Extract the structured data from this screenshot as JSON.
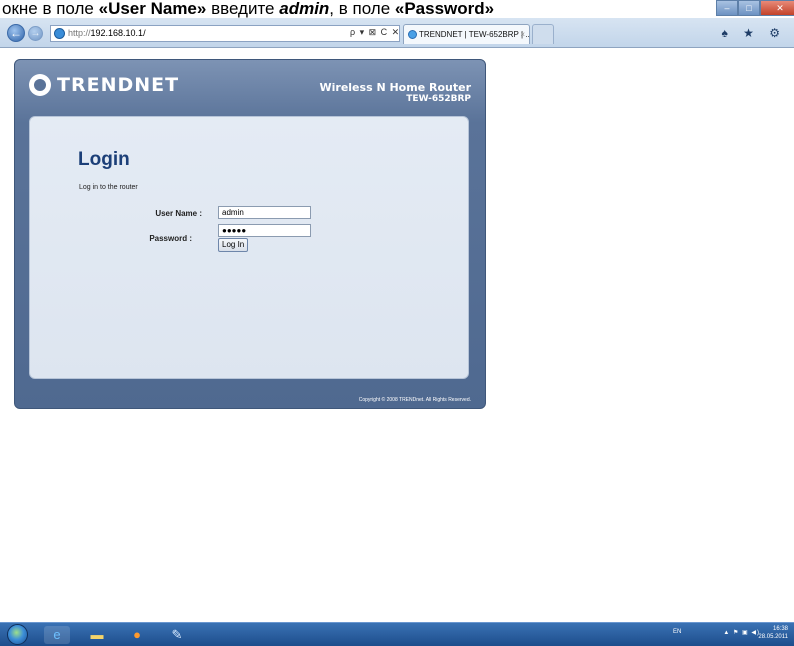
{
  "caption": {
    "text_1": "окне в поле ",
    "bold_1": "«User Name»",
    "text_2": " введите ",
    "italic_1": "admin",
    "text_3": ", в поле ",
    "bold_2": "«Password»"
  },
  "browser": {
    "address_proto": "http://",
    "address_host": "192.168.10.1/",
    "address_tools": "ρ ▾ ⊠ C ✕",
    "tab_title": "TRENDNET | TEW-652BRP | ...",
    "tab_close": "×",
    "toolbar_icons": "♠ ★ ⚙"
  },
  "router": {
    "brand": "TRENDNET",
    "product_name": "Wireless N Home Router",
    "product_model": "TEW-652BRP",
    "login_title": "Login",
    "login_subtitle": "Log in to the router",
    "username_label": "User Name :",
    "username_value": "admin",
    "password_label": "Password :",
    "password_value": "●●●●●",
    "login_button": "Log In",
    "copyright": "Copyright © 2008 TRENDnet. All Rights Reserved."
  },
  "taskbar": {
    "lang": "EN",
    "tray_icons": "▲ ⚑ ▣ ◀)",
    "time": "16:38",
    "date": "28.05.2011"
  },
  "colors": {
    "router_frame": "#5a7399",
    "login_title": "#1c3f78",
    "taskbar": "#1d4d8c"
  }
}
